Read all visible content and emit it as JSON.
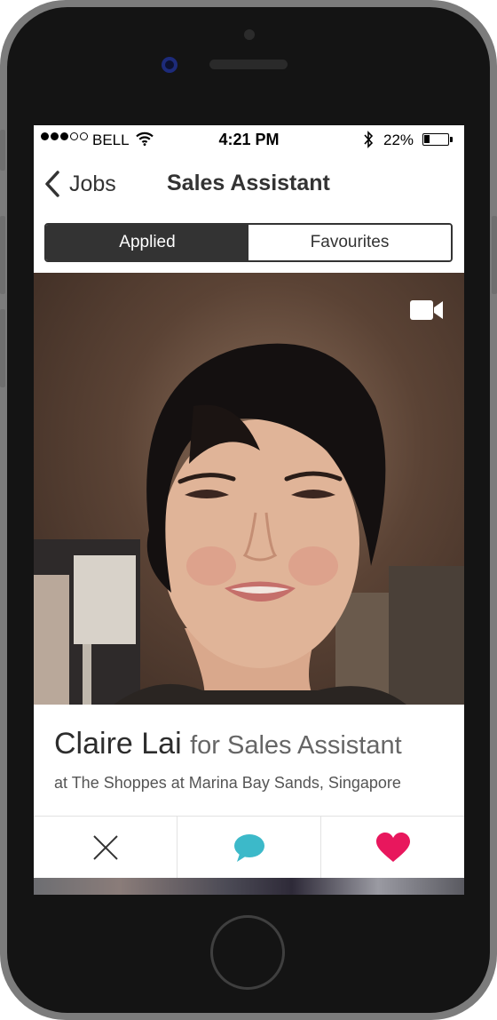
{
  "status_bar": {
    "carrier": "BELL",
    "time": "4:21 PM",
    "battery_percent": "22%",
    "battery_level": 0.22,
    "signal_bars": 3,
    "signal_total": 5
  },
  "nav": {
    "back_label": "Jobs",
    "title": "Sales Assistant"
  },
  "segments": {
    "applied": "Applied",
    "favourites": "Favourites",
    "selected": "Applied"
  },
  "candidate": {
    "name": "Claire Lai",
    "role_text": "for Sales Assistant",
    "location": "at The Shoppes at Marina Bay Sands, Singapore"
  },
  "icons": {
    "video": "video-camera-icon",
    "reject": "close-icon",
    "message": "chat-bubble-icon",
    "favourite": "heart-icon"
  },
  "colors": {
    "dark": "#333333",
    "chat": "#3cb9c9",
    "heart": "#e8175d"
  }
}
